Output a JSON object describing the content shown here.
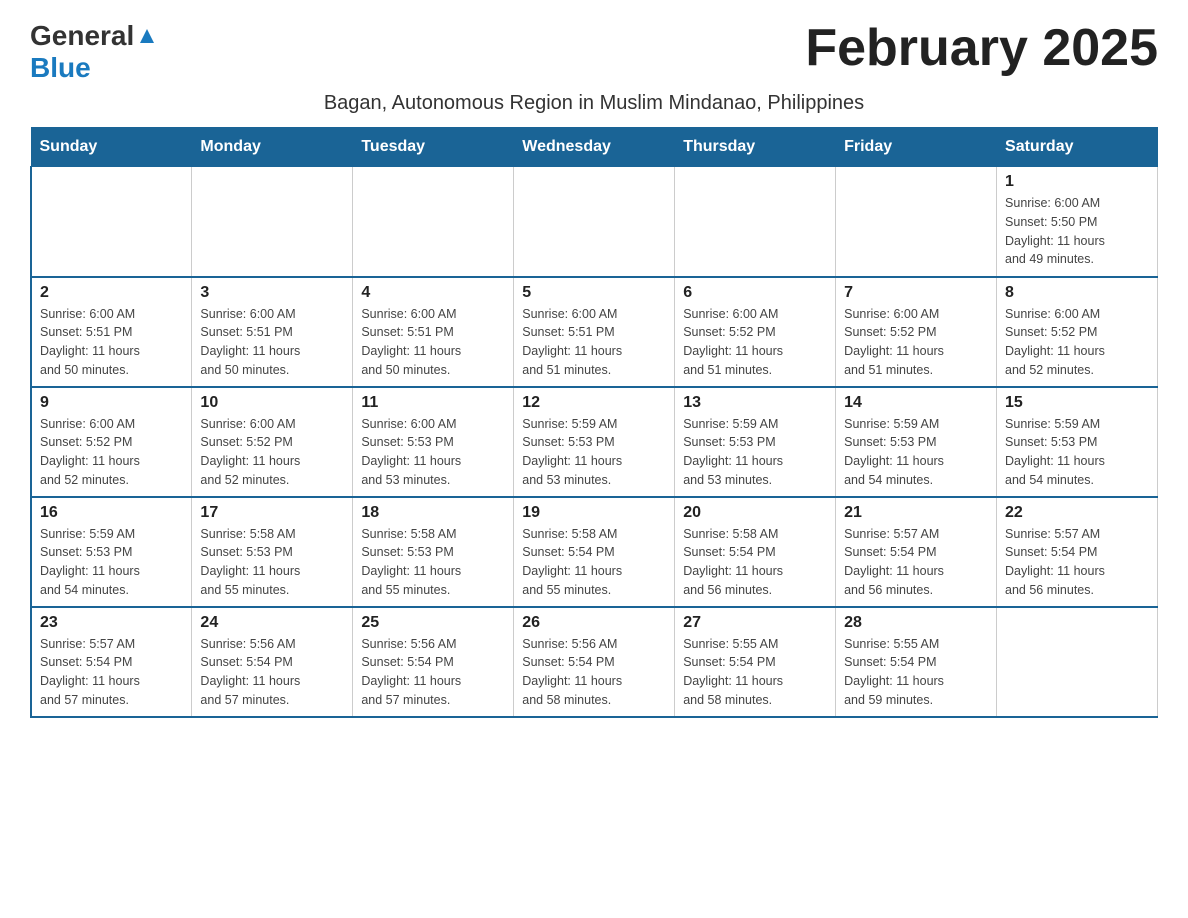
{
  "header": {
    "logo_general": "General",
    "logo_blue": "Blue",
    "month_title": "February 2025",
    "location": "Bagan, Autonomous Region in Muslim Mindanao, Philippines"
  },
  "days_of_week": [
    "Sunday",
    "Monday",
    "Tuesday",
    "Wednesday",
    "Thursday",
    "Friday",
    "Saturday"
  ],
  "weeks": [
    [
      {
        "day": "",
        "info": ""
      },
      {
        "day": "",
        "info": ""
      },
      {
        "day": "",
        "info": ""
      },
      {
        "day": "",
        "info": ""
      },
      {
        "day": "",
        "info": ""
      },
      {
        "day": "",
        "info": ""
      },
      {
        "day": "1",
        "info": "Sunrise: 6:00 AM\nSunset: 5:50 PM\nDaylight: 11 hours\nand 49 minutes."
      }
    ],
    [
      {
        "day": "2",
        "info": "Sunrise: 6:00 AM\nSunset: 5:51 PM\nDaylight: 11 hours\nand 50 minutes."
      },
      {
        "day": "3",
        "info": "Sunrise: 6:00 AM\nSunset: 5:51 PM\nDaylight: 11 hours\nand 50 minutes."
      },
      {
        "day": "4",
        "info": "Sunrise: 6:00 AM\nSunset: 5:51 PM\nDaylight: 11 hours\nand 50 minutes."
      },
      {
        "day": "5",
        "info": "Sunrise: 6:00 AM\nSunset: 5:51 PM\nDaylight: 11 hours\nand 51 minutes."
      },
      {
        "day": "6",
        "info": "Sunrise: 6:00 AM\nSunset: 5:52 PM\nDaylight: 11 hours\nand 51 minutes."
      },
      {
        "day": "7",
        "info": "Sunrise: 6:00 AM\nSunset: 5:52 PM\nDaylight: 11 hours\nand 51 minutes."
      },
      {
        "day": "8",
        "info": "Sunrise: 6:00 AM\nSunset: 5:52 PM\nDaylight: 11 hours\nand 52 minutes."
      }
    ],
    [
      {
        "day": "9",
        "info": "Sunrise: 6:00 AM\nSunset: 5:52 PM\nDaylight: 11 hours\nand 52 minutes."
      },
      {
        "day": "10",
        "info": "Sunrise: 6:00 AM\nSunset: 5:52 PM\nDaylight: 11 hours\nand 52 minutes."
      },
      {
        "day": "11",
        "info": "Sunrise: 6:00 AM\nSunset: 5:53 PM\nDaylight: 11 hours\nand 53 minutes."
      },
      {
        "day": "12",
        "info": "Sunrise: 5:59 AM\nSunset: 5:53 PM\nDaylight: 11 hours\nand 53 minutes."
      },
      {
        "day": "13",
        "info": "Sunrise: 5:59 AM\nSunset: 5:53 PM\nDaylight: 11 hours\nand 53 minutes."
      },
      {
        "day": "14",
        "info": "Sunrise: 5:59 AM\nSunset: 5:53 PM\nDaylight: 11 hours\nand 54 minutes."
      },
      {
        "day": "15",
        "info": "Sunrise: 5:59 AM\nSunset: 5:53 PM\nDaylight: 11 hours\nand 54 minutes."
      }
    ],
    [
      {
        "day": "16",
        "info": "Sunrise: 5:59 AM\nSunset: 5:53 PM\nDaylight: 11 hours\nand 54 minutes."
      },
      {
        "day": "17",
        "info": "Sunrise: 5:58 AM\nSunset: 5:53 PM\nDaylight: 11 hours\nand 55 minutes."
      },
      {
        "day": "18",
        "info": "Sunrise: 5:58 AM\nSunset: 5:53 PM\nDaylight: 11 hours\nand 55 minutes."
      },
      {
        "day": "19",
        "info": "Sunrise: 5:58 AM\nSunset: 5:54 PM\nDaylight: 11 hours\nand 55 minutes."
      },
      {
        "day": "20",
        "info": "Sunrise: 5:58 AM\nSunset: 5:54 PM\nDaylight: 11 hours\nand 56 minutes."
      },
      {
        "day": "21",
        "info": "Sunrise: 5:57 AM\nSunset: 5:54 PM\nDaylight: 11 hours\nand 56 minutes."
      },
      {
        "day": "22",
        "info": "Sunrise: 5:57 AM\nSunset: 5:54 PM\nDaylight: 11 hours\nand 56 minutes."
      }
    ],
    [
      {
        "day": "23",
        "info": "Sunrise: 5:57 AM\nSunset: 5:54 PM\nDaylight: 11 hours\nand 57 minutes."
      },
      {
        "day": "24",
        "info": "Sunrise: 5:56 AM\nSunset: 5:54 PM\nDaylight: 11 hours\nand 57 minutes."
      },
      {
        "day": "25",
        "info": "Sunrise: 5:56 AM\nSunset: 5:54 PM\nDaylight: 11 hours\nand 57 minutes."
      },
      {
        "day": "26",
        "info": "Sunrise: 5:56 AM\nSunset: 5:54 PM\nDaylight: 11 hours\nand 58 minutes."
      },
      {
        "day": "27",
        "info": "Sunrise: 5:55 AM\nSunset: 5:54 PM\nDaylight: 11 hours\nand 58 minutes."
      },
      {
        "day": "28",
        "info": "Sunrise: 5:55 AM\nSunset: 5:54 PM\nDaylight: 11 hours\nand 59 minutes."
      },
      {
        "day": "",
        "info": ""
      }
    ]
  ]
}
